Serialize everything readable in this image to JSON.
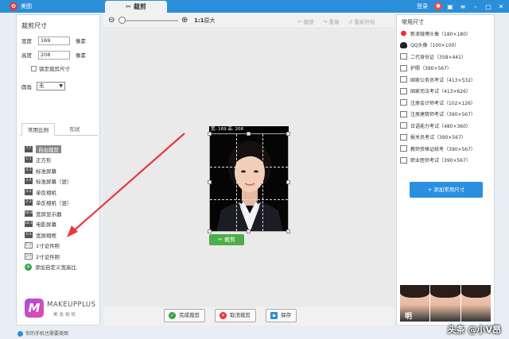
{
  "app": {
    "title": "美图"
  },
  "tab": {
    "label": "裁剪"
  },
  "titlebar": {
    "login": "登录"
  },
  "left": {
    "section_title": "裁剪尺寸",
    "width_label": "宽度",
    "width_value": "169",
    "height_label": "高度",
    "height_value": "208",
    "unit": "像素",
    "lock_label": "锁定裁剪尺寸",
    "shape_label": "圆角",
    "shape_value": "无",
    "tabs": [
      "常用比例",
      "形状"
    ],
    "ratio_items": [
      {
        "icon": "?:?",
        "label": "自由裁剪"
      },
      {
        "icon": "1:1",
        "label": "正方形"
      },
      {
        "icon": "4:3",
        "label": "标准屏幕"
      },
      {
        "icon": "3:4",
        "label": "标准屏幕（竖）"
      },
      {
        "icon": "3:2",
        "label": "单反相机"
      },
      {
        "icon": "2:3",
        "label": "单反相机（竖）"
      },
      {
        "icon": "16:9",
        "label": "宽屏显示器"
      },
      {
        "icon": "16:10",
        "label": "电影屏幕"
      },
      {
        "icon": "5:4",
        "label": "宽屏相框"
      },
      {
        "icon": "1寸",
        "label": "1寸证件照"
      },
      {
        "icon": "2寸",
        "label": "2寸证件照"
      },
      {
        "icon": "+",
        "label": "添加自定义宽高比"
      }
    ],
    "logo_line1": "MAKEUPPLUS",
    "logo_line2": "美妆相机",
    "logo_letter": "M"
  },
  "toolbar": {
    "zoom_11": "1:1",
    "zoom_11_suffix": "原大",
    "undo": "撤销",
    "redo": "重做",
    "reset": "重新开始"
  },
  "photo": {
    "dim_label": "宽: 169  高: 208",
    "crop_button": "裁剪"
  },
  "bottom": {
    "done": "完成裁剪",
    "cancel": "取消裁剪",
    "save": "保存"
  },
  "right": {
    "title": "常用尺寸",
    "sizes": [
      "新浪微博头像（180×180）",
      "QQ头像（100×100）",
      "二代身份证（358×441）",
      "护照（390×567）",
      "国家公务员考试（413×532）",
      "国家司法考试（413×626）",
      "注册会计师考试（102×126）",
      "注册建筑师考试（390×567）",
      "日语能力考试（480×360）",
      "报关员考试（390×567）",
      "教师资格证统考（390×567）",
      "职业医师考试（390×567）"
    ],
    "add_button": "+ 添加常用尺寸",
    "ad_text": "明"
  },
  "status": {
    "text": "你的手机也需要美图"
  },
  "watermark": "头条 @小V昂",
  "colors": {
    "titlebar": "#2a8fd8",
    "accent_green": "#4cae4c",
    "accent_blue": "#2b8fe0",
    "arrow": "#e8383d"
  }
}
